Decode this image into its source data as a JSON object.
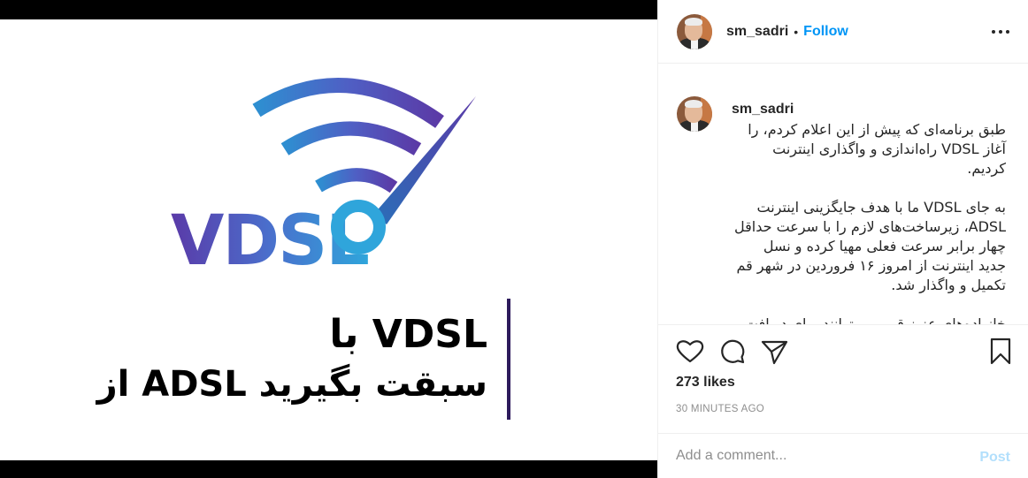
{
  "media": {
    "logo_text": "VDSL",
    "headline_line1": "با VDSL",
    "headline_line2": "از ADSL سبقت بگیرید",
    "colors": {
      "gradient_start": "#4a3aa8",
      "gradient_mid": "#5b62c9",
      "gradient_end": "#2fa5db",
      "text": "#000000",
      "divider": "#2d1b5c"
    }
  },
  "header": {
    "username": "sm_sadri",
    "separator": "•",
    "follow_label": "Follow",
    "more_icon": "more-options-icon"
  },
  "caption": {
    "username": "sm_sadri",
    "paragraphs": [
      "طبق برنامه‌ای که پیش از این اعلام کردم، را آغاز VDSL راه‌اندازی و واگذاری اینترنت کردیم.",
      "به جای VDSL ما با هدف جایگزینی اینترنت ADSL، زیرساخت‌های لازم را با سرعت حداقل چهار برابر سرعت فعلی مهیا کرده و نسل جدید اینترنت از امروز ۱۶ فروردین در شهر قم تکمیل و واگذار شد.",
      "خانواده‌های عزیز قمی می‌توانند برای دریافت اطلاعات بیشتر اقدام کنند."
    ]
  },
  "actions": {
    "icons": [
      "heart-icon",
      "comment-icon",
      "share-icon",
      "bookmark-icon"
    ],
    "likes_text": "273 likes",
    "time_text": "30 MINUTES AGO"
  },
  "add_comment": {
    "placeholder": "Add a comment...",
    "post_label": "Post"
  }
}
